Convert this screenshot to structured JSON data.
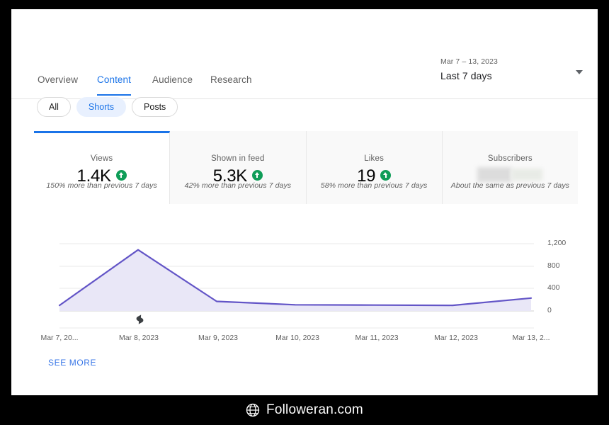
{
  "nav": {
    "tabs": [
      {
        "label": "Overview",
        "active": false
      },
      {
        "label": "Content",
        "active": true
      },
      {
        "label": "Audience",
        "active": false
      },
      {
        "label": "Research",
        "active": false
      }
    ]
  },
  "daterange": {
    "range_text": "Mar 7 – 13, 2023",
    "preset_label": "Last 7 days",
    "caret_icon": "chevron-down-icon"
  },
  "chips": [
    {
      "label": "All",
      "selected": false
    },
    {
      "label": "Shorts",
      "selected": true
    },
    {
      "label": "Posts",
      "selected": false
    }
  ],
  "cards": [
    {
      "title": "Views",
      "value": "1.4K",
      "trend_icon": "arrow-up-circle-icon",
      "note": "150% more than previous 7 days",
      "active": true,
      "redacted": false
    },
    {
      "title": "Shown in feed",
      "value": "5.3K",
      "trend_icon": "arrow-up-circle-icon",
      "note": "42% more than previous 7 days",
      "active": false,
      "redacted": false
    },
    {
      "title": "Likes",
      "value": "19",
      "trend_icon": "arrow-up-circle-icon",
      "note": "58% more than previous 7 days",
      "active": false,
      "redacted": false
    },
    {
      "title": "Subscribers",
      "value": "",
      "trend_icon": "",
      "note": "About the same as previous 7 days",
      "active": false,
      "redacted": true
    }
  ],
  "see_more": {
    "label": "SEE MORE"
  },
  "footer": {
    "site": "Followeran.com",
    "globe_icon": "globe-icon"
  },
  "colors": {
    "accent_blue": "#1a73e8",
    "chart_line": "#6355c7",
    "chart_fill": "#e9e7f7",
    "trend_green": "#0f9d58",
    "link_blue": "#3b78e7"
  },
  "chart_data": {
    "type": "area",
    "title": "Views",
    "xlabel": "",
    "ylabel": "",
    "grid": true,
    "legend": "none",
    "x": [
      "Mar 7, 2023",
      "Mar 8, 2023",
      "Mar 9, 2023",
      "Mar 10, 2023",
      "Mar 11, 2023",
      "Mar 12, 2023",
      "Mar 13, 2023"
    ],
    "xtick_labels": [
      "Mar 7, 20...",
      "Mar 8, 2023",
      "Mar 9, 2023",
      "Mar 10, 2023",
      "Mar 11, 2023",
      "Mar 12, 2023",
      "Mar 13, 2..."
    ],
    "series": [
      {
        "name": "Views",
        "values": [
          100,
          1090,
          170,
          110,
          105,
          100,
          230
        ]
      }
    ],
    "ylim": [
      0,
      1200
    ],
    "ytick_labels": [
      "1,200",
      "800",
      "400",
      "0"
    ],
    "ytick_values": [
      1200,
      800,
      400,
      0
    ],
    "annotations": [
      {
        "icon": "short-video-marker-icon",
        "at_x": "Mar 8, 2023"
      }
    ]
  }
}
